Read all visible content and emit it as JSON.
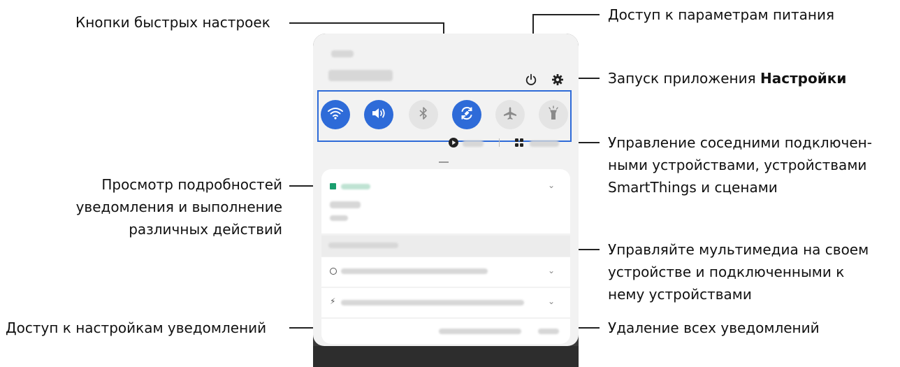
{
  "callouts": {
    "quick_buttons": "Кнопки быстрых настроек",
    "power": "Доступ к параметрам питания",
    "settings_prefix": "Запуск приложения ",
    "settings_bold": "Настройки",
    "devices_1": "Управление соседними подключен-",
    "devices_2": "ными устройствами, устройствами",
    "devices_3": "SmartThings и сценами",
    "details_1": "Просмотр подробностей",
    "details_2": "уведомления и выполнение",
    "details_3": "различных действий",
    "media_1": "Управляйте мультимедиа на своем",
    "media_2": "устройстве и подключенными к",
    "media_3": "нему устройствами",
    "notif_settings": "Доступ к настройкам уведомлений",
    "clear_all": "Удаление всех уведомлений"
  },
  "icons": {
    "power": "power-icon",
    "settings": "gear-icon",
    "quick": [
      "wifi-icon",
      "sound-icon",
      "bluetooth-icon",
      "auto-rotate-icon",
      "airplane-icon",
      "flashlight-icon"
    ],
    "media": "play-icon",
    "devices": "grid-icon"
  },
  "colors": {
    "accent": "#2e6bd8",
    "calendar_green": "#1a9e6e"
  }
}
